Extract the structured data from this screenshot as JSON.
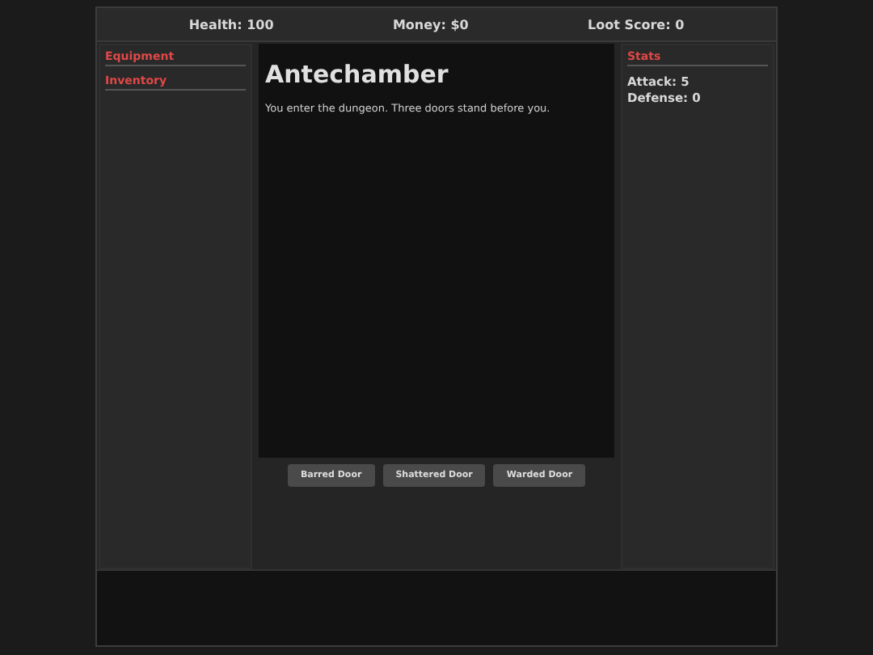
{
  "status_bar": [
    {
      "label": "Health: 100"
    },
    {
      "label": "Money: $0"
    },
    {
      "label": "Loot Score: 0"
    }
  ],
  "left_sidebar": {
    "sections": [
      {
        "heading": "Equipment"
      },
      {
        "heading": "Inventory"
      }
    ]
  },
  "room": {
    "title": "Antechamber",
    "description": "You enter the dungeon. Three doors stand before you."
  },
  "actions": [
    "Barred Door",
    "Shattered Door",
    "Warded Door"
  ],
  "right_sidebar": {
    "heading": "Stats",
    "stats": [
      "Attack: 5",
      "Defense: 0"
    ]
  }
}
